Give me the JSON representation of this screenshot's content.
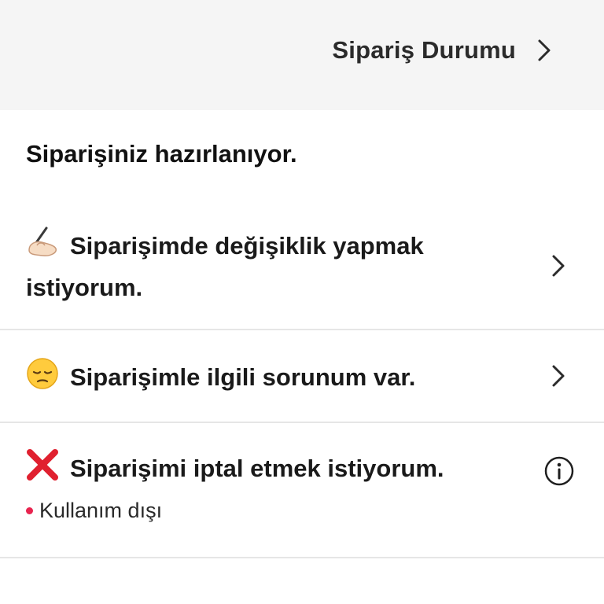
{
  "header": {
    "order_status_label": "Sipariş Durumu"
  },
  "status": {
    "text": "Siparişiniz hazırlanıyor."
  },
  "options": [
    {
      "emoji": "writing-hand-icon",
      "line1": "Siparişimde değişiklik yapmak",
      "line2": "istiyorum.",
      "action": "chevron-right-icon"
    },
    {
      "emoji": "pensive-face-icon",
      "label": "Siparişimle ilgili sorunum var.",
      "action": "chevron-right-icon"
    },
    {
      "emoji": "cross-mark-icon",
      "label": "Siparişimi iptal etmek istiyorum.",
      "action": "info-icon",
      "note": "Kullanım dışı",
      "note_color": "#e8244f"
    }
  ],
  "colors": {
    "header_bg": "#f5f5f5",
    "divider": "#e6e6e6",
    "cross_red": "#e0202f"
  }
}
